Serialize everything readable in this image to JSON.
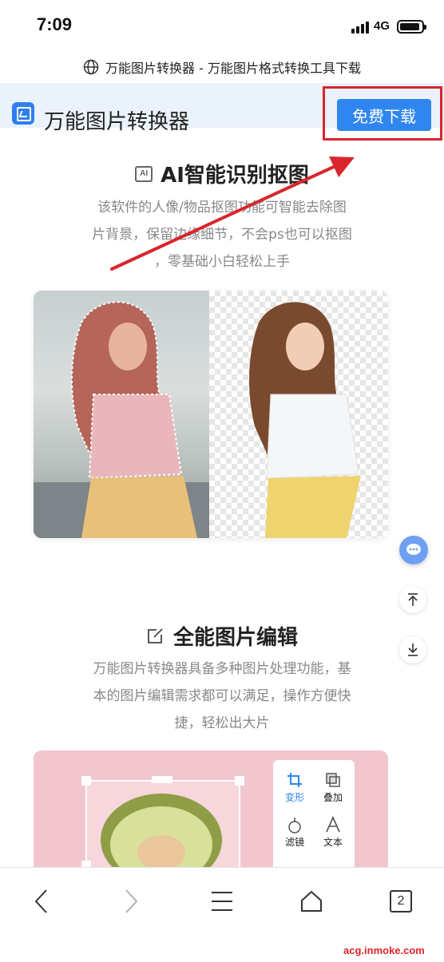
{
  "status_bar": {
    "time": "7:09",
    "network": "4G"
  },
  "browser": {
    "page_title": "万能图片转换器 - 万能图片格式转换工具下载",
    "tab_count": "2"
  },
  "site": {
    "name": "万能图片转换器",
    "download_label": "免费下载"
  },
  "sections": [
    {
      "icon_label": "AI",
      "title": "AI智能识别抠图",
      "desc_lines": [
        "该软件的人像/物品抠图功能可智能去除图",
        "片背景，保留边缘细节，不会ps也可以抠图",
        "，零基础小白轻松上手"
      ]
    },
    {
      "title": "全能图片编辑",
      "desc_lines": [
        "万能图片转换器具备多种图片处理功能，基",
        "本的图片编辑需求都可以满足，操作方便快",
        "捷，轻松出大片"
      ]
    }
  ],
  "editor_tools": [
    "变形",
    "叠加",
    "滤镜",
    "文本"
  ],
  "watermark": "acg.inmoke.com",
  "colors": {
    "accent": "#2f86f0",
    "highlight_box": "#d8262c",
    "header_bg": "#eaf2fc"
  },
  "icons": [
    "globe-icon",
    "app-logo-icon",
    "ai-icon",
    "edit-icon",
    "chat-icon",
    "scroll-top-icon",
    "download-icon",
    "back-icon",
    "forward-icon",
    "menu-icon",
    "home-icon"
  ]
}
